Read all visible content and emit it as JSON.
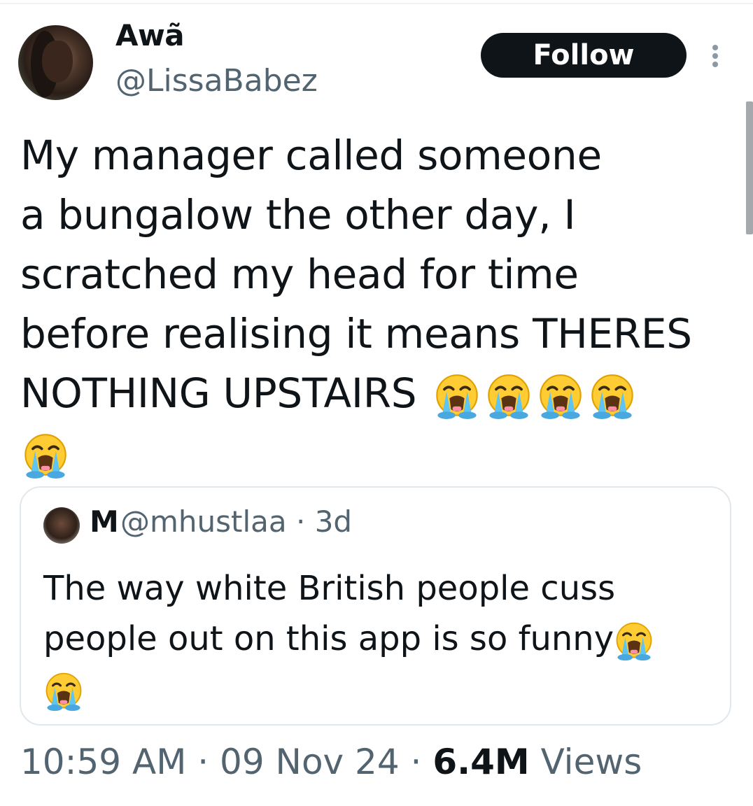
{
  "author": {
    "display_name": "Awã",
    "handle": "@LissaBabez"
  },
  "follow_button": {
    "label": "Follow"
  },
  "more_icon": "more-vertical-icon",
  "tweet": {
    "lines": [
      "My manager called someone",
      "a bungalow the other day, I",
      "scratched my head for time",
      "before realising it means THERES",
      "NOTHING UPSTAIRS "
    ],
    "emoji": "loudly-crying-face-emoji",
    "emoji_count_line5": 4,
    "emoji_count_line6": 1
  },
  "quote": {
    "name": "M",
    "meta": "@mhustlaa · 3d",
    "lines": [
      "The way white British people cuss",
      "people out on this app is so funny"
    ]
  },
  "footer": {
    "time": "10:59 AM",
    "sep1": " · ",
    "date": "09 Nov 24",
    "sep2": " · ",
    "views_count": "6.4M",
    "views_label": " Views"
  },
  "colors": {
    "text": "#0f1419",
    "secondary": "#536471",
    "button_bg": "#0f1419",
    "border": "#e1e8ed"
  }
}
